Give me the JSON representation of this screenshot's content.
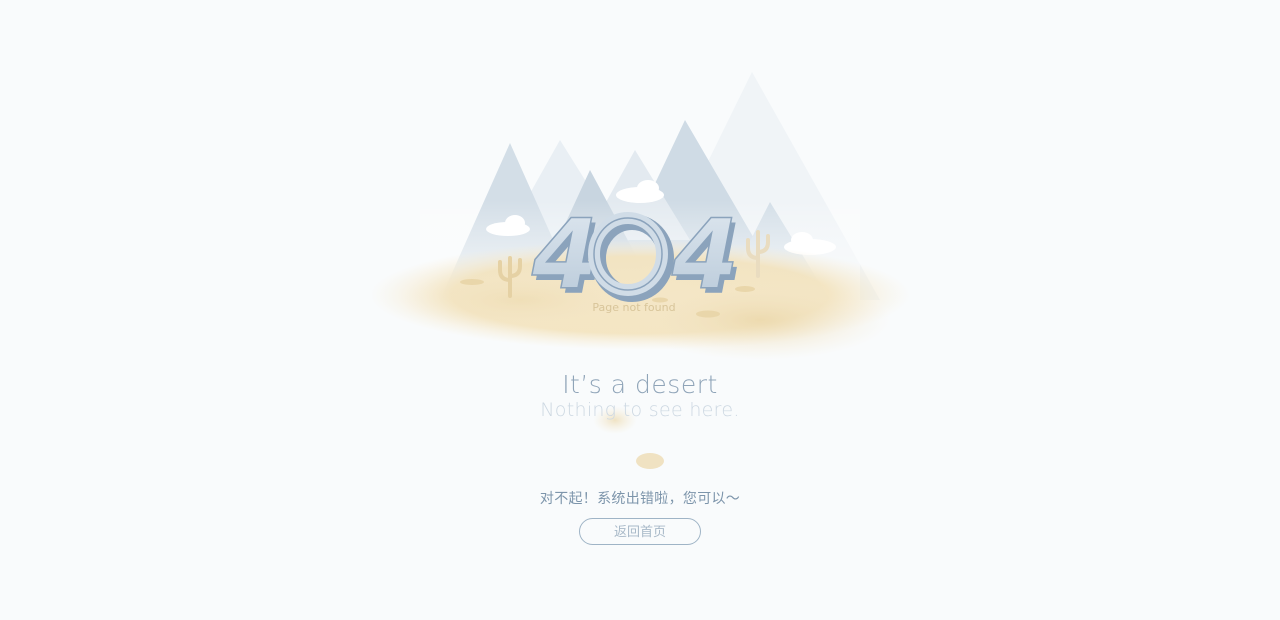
{
  "illustration": {
    "code": "404",
    "caption": "Page not found",
    "colors": {
      "mountain_dark": "#c5d3de",
      "mountain_light": "#e6edf2",
      "sand": "#f3e5c4",
      "sand_shadow": "#e7d4a7",
      "cactus": "#e6d3a8",
      "number_face": "#c6d4e2",
      "number_side": "#8ba3bc"
    }
  },
  "message": {
    "title": "It’s a desert",
    "subtitle": "Nothing to see here."
  },
  "apology_text": "对不起！系统出错啦，您可以～",
  "home_button_label": "返回首页"
}
